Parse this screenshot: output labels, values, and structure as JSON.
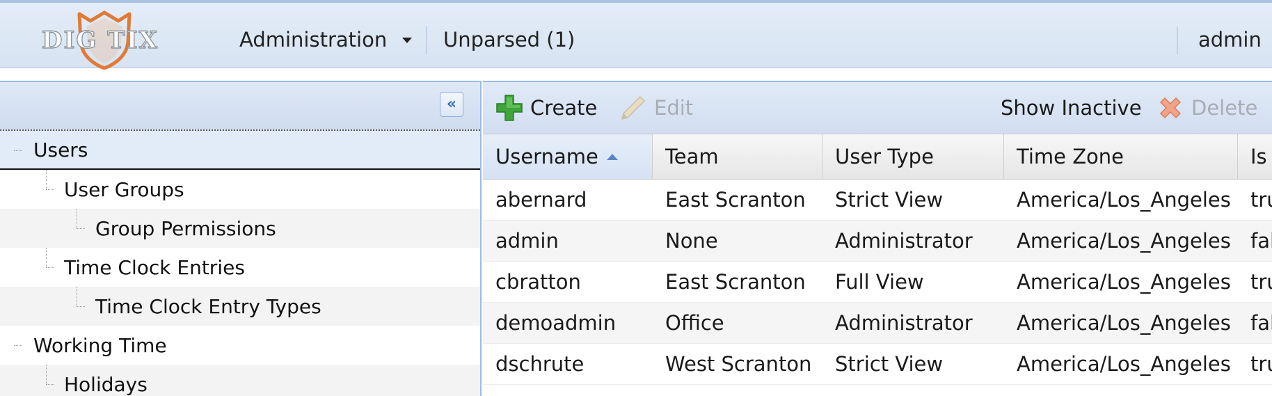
{
  "header": {
    "logo_text": "DIG TIX",
    "menu_label": "Administration",
    "unparsed_label": "Unparsed (1)",
    "user_label": "admin"
  },
  "tree": {
    "collapse_glyph": "«",
    "items": [
      {
        "label": "Users",
        "level": 0,
        "selected": true
      },
      {
        "label": "User Groups",
        "level": 1
      },
      {
        "label": "Group Permissions",
        "level": 2
      },
      {
        "label": "Time Clock Entries",
        "level": 1
      },
      {
        "label": "Time Clock Entry Types",
        "level": 2
      },
      {
        "label": "Working Time",
        "level": 0
      },
      {
        "label": "Holidays",
        "level": 1
      }
    ]
  },
  "toolbar": {
    "create_label": "Create",
    "edit_label": "Edit",
    "show_inactive_label": "Show Inactive",
    "delete_label": "Delete"
  },
  "grid": {
    "columns": [
      "Username",
      "Team",
      "User Type",
      "Time Zone",
      "Is"
    ],
    "sorted_column": "Username",
    "sort_direction": "ascending",
    "rows": [
      {
        "username": "abernard",
        "team": "East Scranton",
        "user_type": "Strict View",
        "time_zone": "America/Los_Angeles",
        "is": "tru"
      },
      {
        "username": "admin",
        "team": "None",
        "user_type": "Administrator",
        "time_zone": "America/Los_Angeles",
        "is": "fal"
      },
      {
        "username": "cbratton",
        "team": "East Scranton",
        "user_type": "Full View",
        "time_zone": "America/Los_Angeles",
        "is": "tru"
      },
      {
        "username": "demoadmin",
        "team": "Office",
        "user_type": "Administrator",
        "time_zone": "America/Los_Angeles",
        "is": "fal"
      },
      {
        "username": "dschrute",
        "team": "West Scranton",
        "user_type": "Strict View",
        "time_zone": "America/Los_Angeles",
        "is": "tru"
      }
    ]
  },
  "colors": {
    "accent": "#99bbe8",
    "logo_orange": "#e07a35",
    "create_green": "#3fa43a",
    "delete_red": "#e06a4a"
  }
}
